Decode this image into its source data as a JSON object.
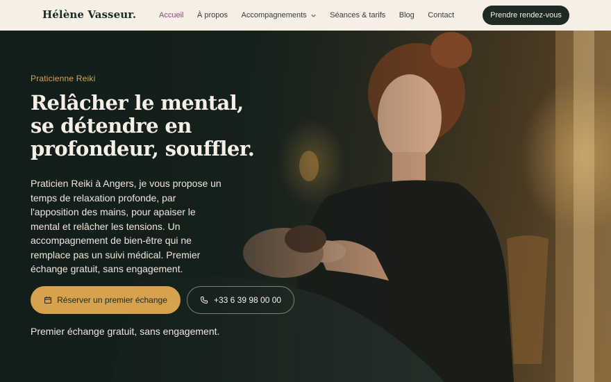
{
  "header": {
    "brand": "Hélène Vasseur.",
    "nav": [
      {
        "label": "Accueil",
        "active": true
      },
      {
        "label": "À propos",
        "active": false
      },
      {
        "label": "Accompagnements",
        "active": false,
        "dropdown": true
      },
      {
        "label": "Séances & tarifs",
        "active": false
      },
      {
        "label": "Blog",
        "active": false
      },
      {
        "label": "Contact",
        "active": false
      }
    ],
    "cta_label": "Prendre rendez-vous"
  },
  "hero": {
    "eyebrow": "Praticienne Reiki",
    "headline": "Relâcher le mental, se détendre en profondeur, souffler.",
    "lead": "Praticien Reiki à Angers, je vous propose un temps de relaxation profonde, par l'apposition des mains, pour apaiser le mental et relâcher les tensions. Un accompagnement de bien-être qui ne remplace pas un suivi médical. Premier échange gratuit, sans engagement.",
    "primary_button": {
      "label": "Réserver un premier échange",
      "icon": "calendar-icon"
    },
    "phone_button": {
      "label": "+33 6 39 98 00 00",
      "icon": "phone-icon"
    },
    "note": "Premier échange gratuit, sans engagement."
  },
  "colors": {
    "header_bg": "#f6efe6",
    "dark_green": "#1e2a24",
    "accent_gold": "#d6a24d",
    "nav_active": "#8a4b78"
  }
}
